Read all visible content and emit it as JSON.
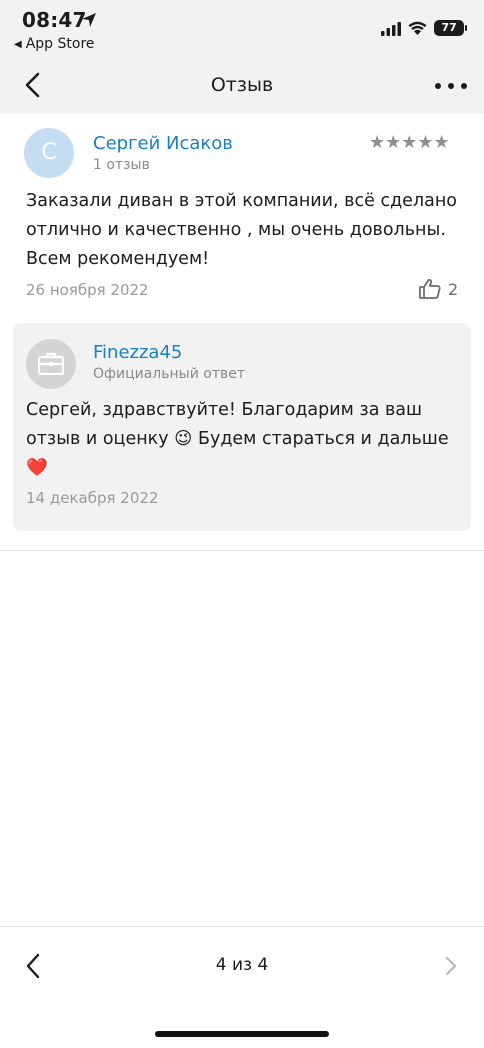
{
  "status_bar": {
    "time": "08:47",
    "back_app": "App Store",
    "battery": "77"
  },
  "nav": {
    "title": "Отзыв"
  },
  "review": {
    "avatar_initial": "С",
    "author": "Сергей Исаков",
    "author_meta": "1 отзыв",
    "stars": "★★★★★",
    "rating": 5,
    "text": "Заказали диван в этой компании, всё сделано отлично и качественно , мы очень довольны. Всем рекомендуем!",
    "date": "26 ноября 2022",
    "likes": "2"
  },
  "reply": {
    "author": "Finezza45",
    "meta": "Официальный ответ",
    "text": "Сергей, здравствуйте! Благодарим за ваш отзыв и оценку 😉 Будем стараться и дальше ❤️",
    "date": "14 декабря 2022"
  },
  "pager": {
    "label": "4 из 4"
  },
  "colors": {
    "link": "#1a7fc4",
    "header_bg": "#f2f2f2",
    "avatar_bg": "#c5ddf2"
  },
  "icons": {
    "location": "location-arrow-icon",
    "back": "chevron-left-icon",
    "more": "ellipsis-icon",
    "like": "thumbs-up-icon",
    "briefcase": "briefcase-icon",
    "next": "chevron-right-icon"
  }
}
